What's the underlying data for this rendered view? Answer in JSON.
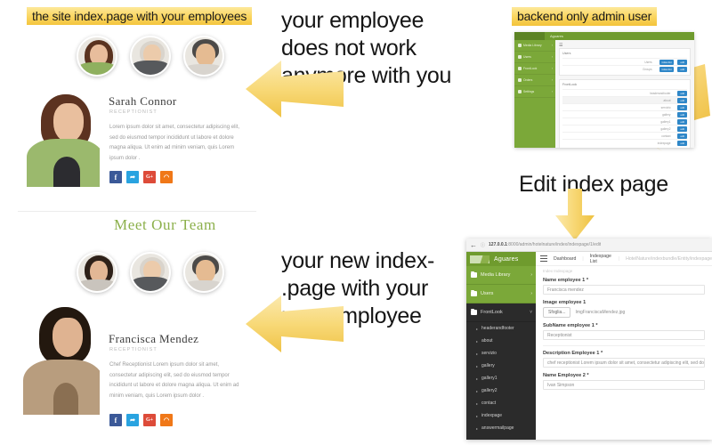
{
  "captions": {
    "top_left": "the site index.page with your employees",
    "top_right": "backend only admin user"
  },
  "callouts": {
    "upper_line1": "your employee",
    "upper_line2": "does not work",
    "upper_line3": "anymore with you",
    "lower_line1": "your new index-",
    "lower_line2": ".page with your",
    "lower_line3": "new employee",
    "index_list": "index.list",
    "edit_index_page": "Edit index page"
  },
  "site": {
    "old_profile": {
      "name": "Sarah Connor",
      "role": "RECEPTIONIST",
      "body": "Lorem ipsum dolor sit amet, consectetur adipiscing elit, sed do eiusmod tempor incididunt ut labore et dolore magna aliqua. Ut enim ad minim veniam, quis Lorem ipsum dolor ."
    },
    "new_profile": {
      "name": "Francisca Mendez",
      "role": "RECEPTIONIST",
      "body": "Chef Receptionist Lorem ipsum dolor sit amet, consectetur adipiscing elit, sed do eiusmod tempor incididunt ut labore et dolore magna aliqua. Ut enim ad minim veniam, quis Lorem ipsum dolor ."
    },
    "meet_our_team": "Meet Our Team",
    "social": [
      {
        "name": "facebook",
        "glyph": "f",
        "color": "#3b5998"
      },
      {
        "name": "twitter",
        "glyph": "t",
        "color": "#29a3e0"
      },
      {
        "name": "google-plus",
        "glyph": "G+",
        "color": "#dd4b39"
      },
      {
        "name": "rss",
        "glyph": "◔",
        "color": "#f07818"
      }
    ]
  },
  "admin_small": {
    "brand": "Aguares",
    "sidebar": [
      {
        "label": "Media Library",
        "chevron": "›"
      },
      {
        "label": "Users",
        "chevron": "›"
      },
      {
        "label": "FrontLook",
        "chevron": "›"
      },
      {
        "label": "Orders",
        "chevron": "›"
      },
      {
        "label": "Settings",
        "chevron": "›"
      }
    ],
    "card_users_title": "Users",
    "card_front_title": "FrontLook",
    "user_rows": [
      {
        "label": "Users",
        "buttons": [
          "index.list",
          "edit"
        ]
      },
      {
        "label": "Groups",
        "buttons": [
          "index.list",
          "edit"
        ]
      }
    ],
    "front_rows": [
      {
        "label": "headerandfooter",
        "buttons": [
          "edit"
        ]
      },
      {
        "label": "about",
        "buttons": [
          "edit"
        ]
      },
      {
        "label": "servizio",
        "buttons": [
          "edit"
        ]
      },
      {
        "label": "gallery",
        "buttons": [
          "edit"
        ]
      },
      {
        "label": "gallery1",
        "buttons": [
          "edit"
        ]
      },
      {
        "label": "gallery2",
        "buttons": [
          "edit"
        ]
      },
      {
        "label": "contact",
        "buttons": [
          "edit"
        ]
      },
      {
        "label": "indexpage",
        "buttons": [
          "edit"
        ]
      }
    ]
  },
  "admin_big": {
    "url_host": "127.0.0.1",
    "url_path": ":8000/admin/hotelnature/index/indexpage/1/edit",
    "brand": "Aguares",
    "nav_green": [
      {
        "label": "Media Library",
        "arrow": "›"
      },
      {
        "label": "Users",
        "arrow": "›"
      }
    ],
    "nav_dark": {
      "label": "FrontLook",
      "arrow": "˅"
    },
    "nav_sub": [
      "headerandfooter",
      "about",
      "servizio",
      "gallery",
      "gallery1",
      "gallery2",
      "contact",
      "indexpage",
      "answermailpage"
    ],
    "breadcrumb": {
      "dashboard": "Dashboard",
      "list": "Indexpage List",
      "path": "HotelNature/indexbundle/Entity/indexpage"
    },
    "form_heading": "Index Indexpage",
    "fields": [
      {
        "label": "Name employee 1 *",
        "value": "Francisca mendez",
        "type": "text"
      },
      {
        "label": "Image employee 1",
        "value": "ImgFranciscaMendez.jpg",
        "type": "file",
        "button": "Sfoglia..."
      },
      {
        "label": "SubName employee 1 *",
        "value": "Receptionist",
        "type": "text"
      },
      {
        "label": "Description Employee 1 *",
        "value": "chef receptionist Lorem ipsum dolor sit amet, consectetur adipiscing elit, sed do",
        "type": "text"
      },
      {
        "label": "Name Employee 2 *",
        "value": "Ivan Simpson",
        "type": "text"
      }
    ]
  },
  "colors": {
    "banner_yellow": "#f3c33a",
    "arrow_yellow": "#f6d571",
    "admin_green": "#7ba839",
    "admin_dark": "#2b2b2b",
    "team_green": "#8cb04b"
  }
}
